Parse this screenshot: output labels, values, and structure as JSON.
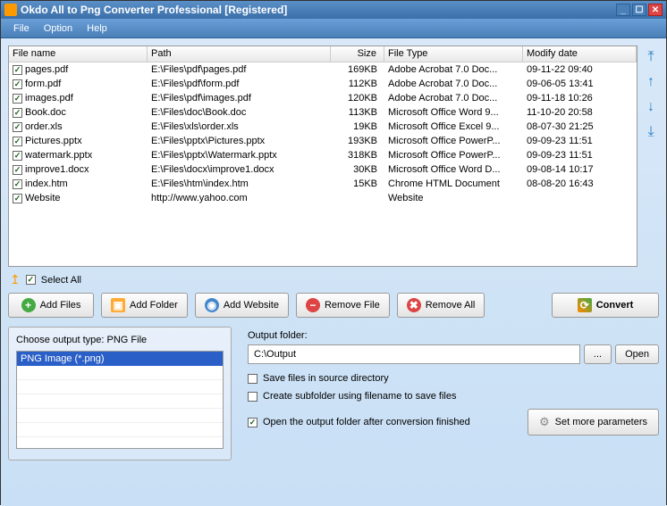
{
  "window": {
    "title": "Okdo All to Png Converter Professional [Registered]"
  },
  "menu": {
    "file": "File",
    "option": "Option",
    "help": "Help"
  },
  "columns": {
    "name": "File name",
    "path": "Path",
    "size": "Size",
    "type": "File Type",
    "date": "Modify date"
  },
  "files": [
    {
      "name": "pages.pdf",
      "path": "E:\\Files\\pdf\\pages.pdf",
      "size": "169KB",
      "type": "Adobe Acrobat 7.0 Doc...",
      "date": "09-11-22 09:40"
    },
    {
      "name": "form.pdf",
      "path": "E:\\Files\\pdf\\form.pdf",
      "size": "112KB",
      "type": "Adobe Acrobat 7.0 Doc...",
      "date": "09-06-05 13:41"
    },
    {
      "name": "images.pdf",
      "path": "E:\\Files\\pdf\\images.pdf",
      "size": "120KB",
      "type": "Adobe Acrobat 7.0 Doc...",
      "date": "09-11-18 10:26"
    },
    {
      "name": "Book.doc",
      "path": "E:\\Files\\doc\\Book.doc",
      "size": "113KB",
      "type": "Microsoft Office Word 9...",
      "date": "11-10-20 20:58"
    },
    {
      "name": "order.xls",
      "path": "E:\\Files\\xls\\order.xls",
      "size": "19KB",
      "type": "Microsoft Office Excel 9...",
      "date": "08-07-30 21:25"
    },
    {
      "name": "Pictures.pptx",
      "path": "E:\\Files\\pptx\\Pictures.pptx",
      "size": "193KB",
      "type": "Microsoft Office PowerP...",
      "date": "09-09-23 11:51"
    },
    {
      "name": "watermark.pptx",
      "path": "E:\\Files\\pptx\\Watermark.pptx",
      "size": "318KB",
      "type": "Microsoft Office PowerP...",
      "date": "09-09-23 11:51"
    },
    {
      "name": "improve1.docx",
      "path": "E:\\Files\\docx\\improve1.docx",
      "size": "30KB",
      "type": "Microsoft Office Word D...",
      "date": "09-08-14 10:17"
    },
    {
      "name": "index.htm",
      "path": "E:\\Files\\htm\\index.htm",
      "size": "15KB",
      "type": "Chrome HTML Document",
      "date": "08-08-20 16:43"
    },
    {
      "name": "Website",
      "path": "http://www.yahoo.com",
      "size": "",
      "type": "Website",
      "date": ""
    }
  ],
  "selectAll": "Select All",
  "buttons": {
    "addFiles": "Add Files",
    "addFolder": "Add Folder",
    "addWebsite": "Add Website",
    "removeFile": "Remove File",
    "removeAll": "Remove All",
    "convert": "Convert"
  },
  "outputTypeLabel": "Choose output type:",
  "outputTypeValue": "PNG File",
  "typeOption": "PNG Image (*.png)",
  "outputFolderLabel": "Output folder:",
  "outputFolderValue": "C:\\Output",
  "browse": "...",
  "open": "Open",
  "opt1": "Save files in source directory",
  "opt2": "Create subfolder using filename to save files",
  "opt3": "Open the output folder after conversion finished",
  "setMore": "Set more parameters"
}
